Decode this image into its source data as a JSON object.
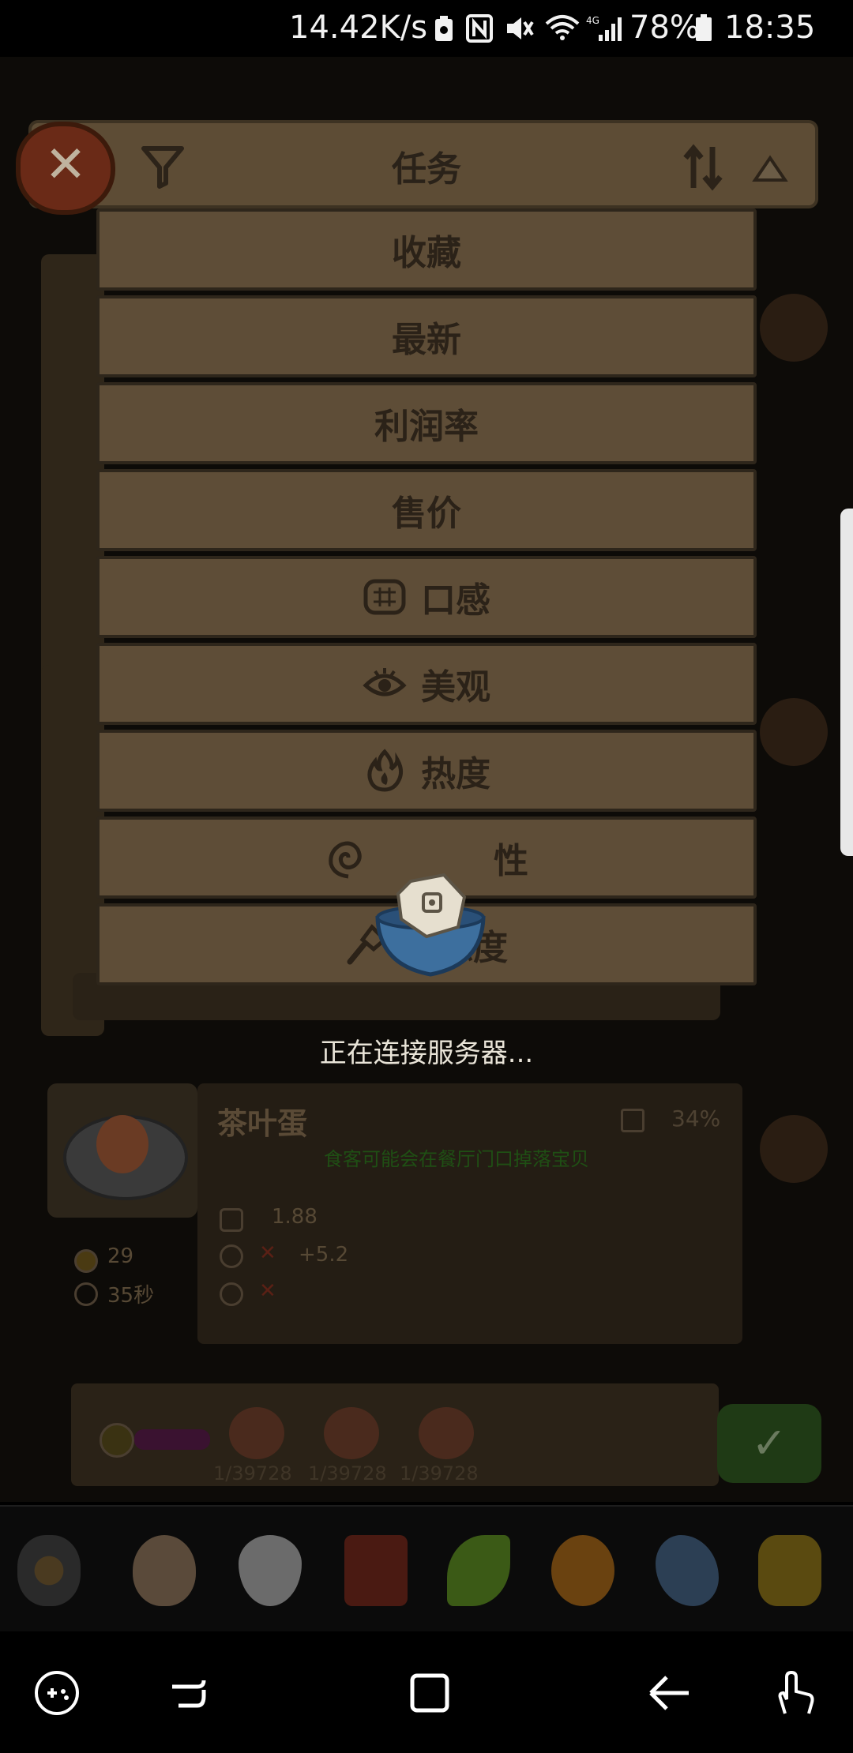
{
  "status_bar": {
    "net_speed": "14.42K/s",
    "battery": "78%",
    "time": "18:35",
    "icons": [
      "battery-saver-icon",
      "nfc-icon",
      "mute-icon",
      "wifi-icon",
      "signal-4g-icon",
      "battery-icon"
    ]
  },
  "header": {
    "title": "任务",
    "close_icon": "close-icon",
    "filter_icon": "filter-icon",
    "sort_icon": "sort-icon",
    "collapse_icon": "triangle-up-icon"
  },
  "sort_menu": {
    "items": [
      {
        "label": "收藏",
        "icon": ""
      },
      {
        "label": "最新",
        "icon": ""
      },
      {
        "label": "利润率",
        "icon": ""
      },
      {
        "label": "售价",
        "icon": ""
      },
      {
        "label": "口感",
        "icon": "taste-icon"
      },
      {
        "label": "美观",
        "icon": "eye-icon"
      },
      {
        "label": "热度",
        "icon": "flame-icon"
      },
      {
        "label": "性",
        "icon": "spiral-icon"
      },
      {
        "label": "熟练度",
        "icon": "spatula-icon"
      }
    ]
  },
  "loading": {
    "text": "正在连接服务器..."
  },
  "dish_card": {
    "name": "茶叶蛋",
    "mastery": "34%",
    "tip": "食客可能会在餐厅门口掉落宝贝",
    "taste_value": "1.88",
    "appearance_bonus": "+5.2",
    "price": "29",
    "time": "35秒",
    "rewards": [
      "1/39728",
      "1/39728",
      "1/39728"
    ]
  },
  "ingredient_bar": {
    "items": [
      "all-ingredients-icon",
      "egg-icon",
      "water-drop-icon",
      "meat-icon",
      "leaf-icon",
      "orange-icon",
      "fish-icon",
      "grain-icon"
    ]
  },
  "nav_bar": {
    "items": [
      "game-tools-icon",
      "recent-apps-icon",
      "home-icon",
      "back-icon",
      "gesture-icon"
    ]
  },
  "colors": {
    "panel": "#5e4d37",
    "panel_border": "#2e261b",
    "menu_text": "#2b2218",
    "loading_text": "#e9e4d8"
  }
}
